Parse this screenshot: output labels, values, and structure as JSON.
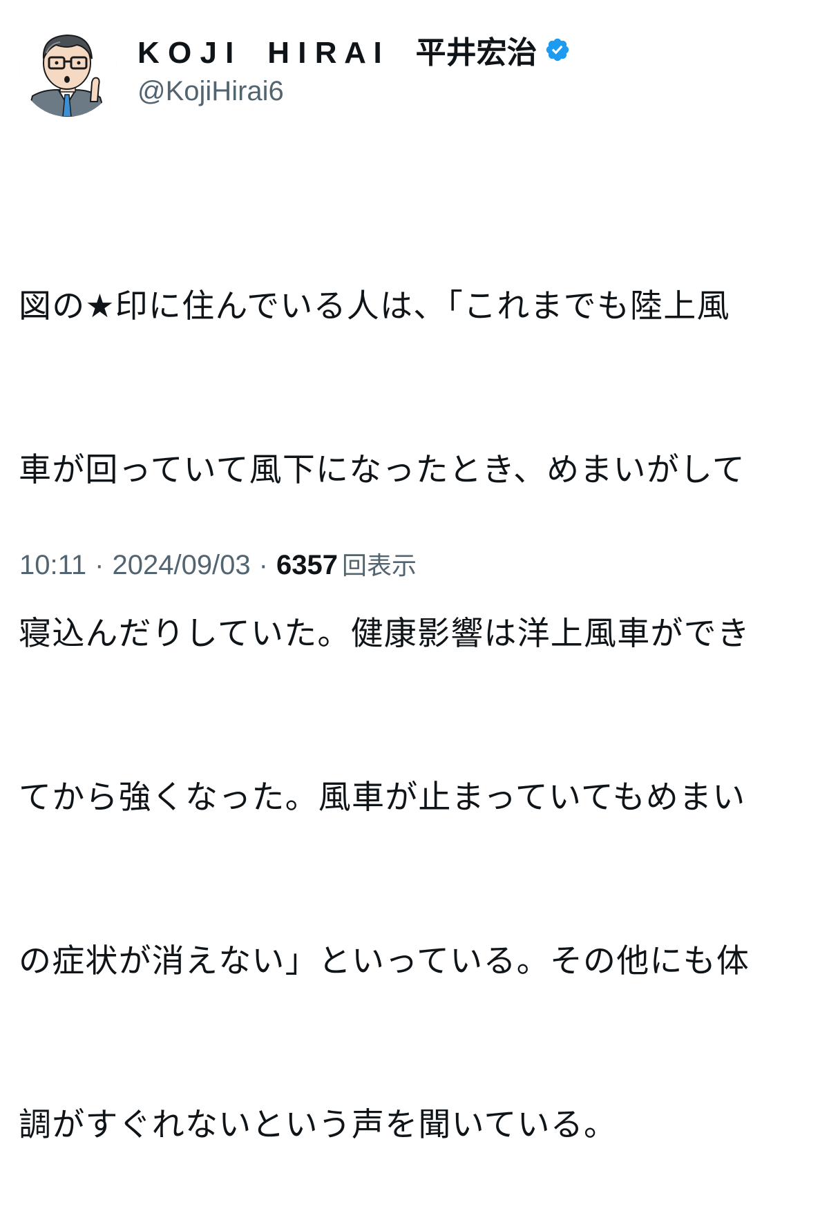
{
  "author": {
    "display_name": "K O J I    H I R A I    平井宏治",
    "handle": "@KojiHirai6",
    "verified": true,
    "avatar": "illustrated-man-with-glasses-avatar"
  },
  "tweet": {
    "lines": [
      "図の★印に住んでいる人は、「これまでも陸上風",
      "車が回っていて風下になったとき、めまいがして",
      "寝込んだりしていた。健康影響は洋上風車ができ",
      "てから強くなった。風車が止まっていてもめまい",
      "の症状が消えない」といっている。その他にも体",
      "調がすぐれないという声を聞いている。"
    ]
  },
  "meta": {
    "time": "10:11",
    "separator": "·",
    "date": "2024/09/03",
    "views_count": "6357",
    "views_label": "回表示"
  },
  "colors": {
    "text": "#0f1419",
    "secondary": "#536471",
    "verified_blue": "#1d9bf0"
  }
}
